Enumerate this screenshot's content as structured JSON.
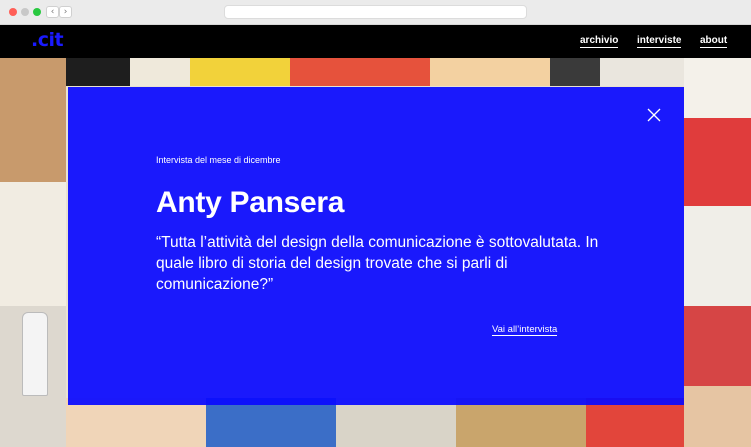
{
  "site": {
    "logo": ".cit",
    "nav": [
      {
        "label": "archivio"
      },
      {
        "label": "interviste"
      },
      {
        "label": "about"
      }
    ]
  },
  "browser": {
    "back_glyph": "‹",
    "forward_glyph": "›"
  },
  "modal": {
    "kicker": "Intervista del mese di dicembre",
    "name": "Anty Pansera",
    "quote": "“Tutta l’attività del design della comunicazione è sottovalutata. In quale libro di storia del design trovate che si parli di comunicazione?”",
    "link_label": "Vai all’intervista",
    "close_icon": "close-icon"
  },
  "colors": {
    "accent": "#0a0aff",
    "header": "#000000"
  }
}
